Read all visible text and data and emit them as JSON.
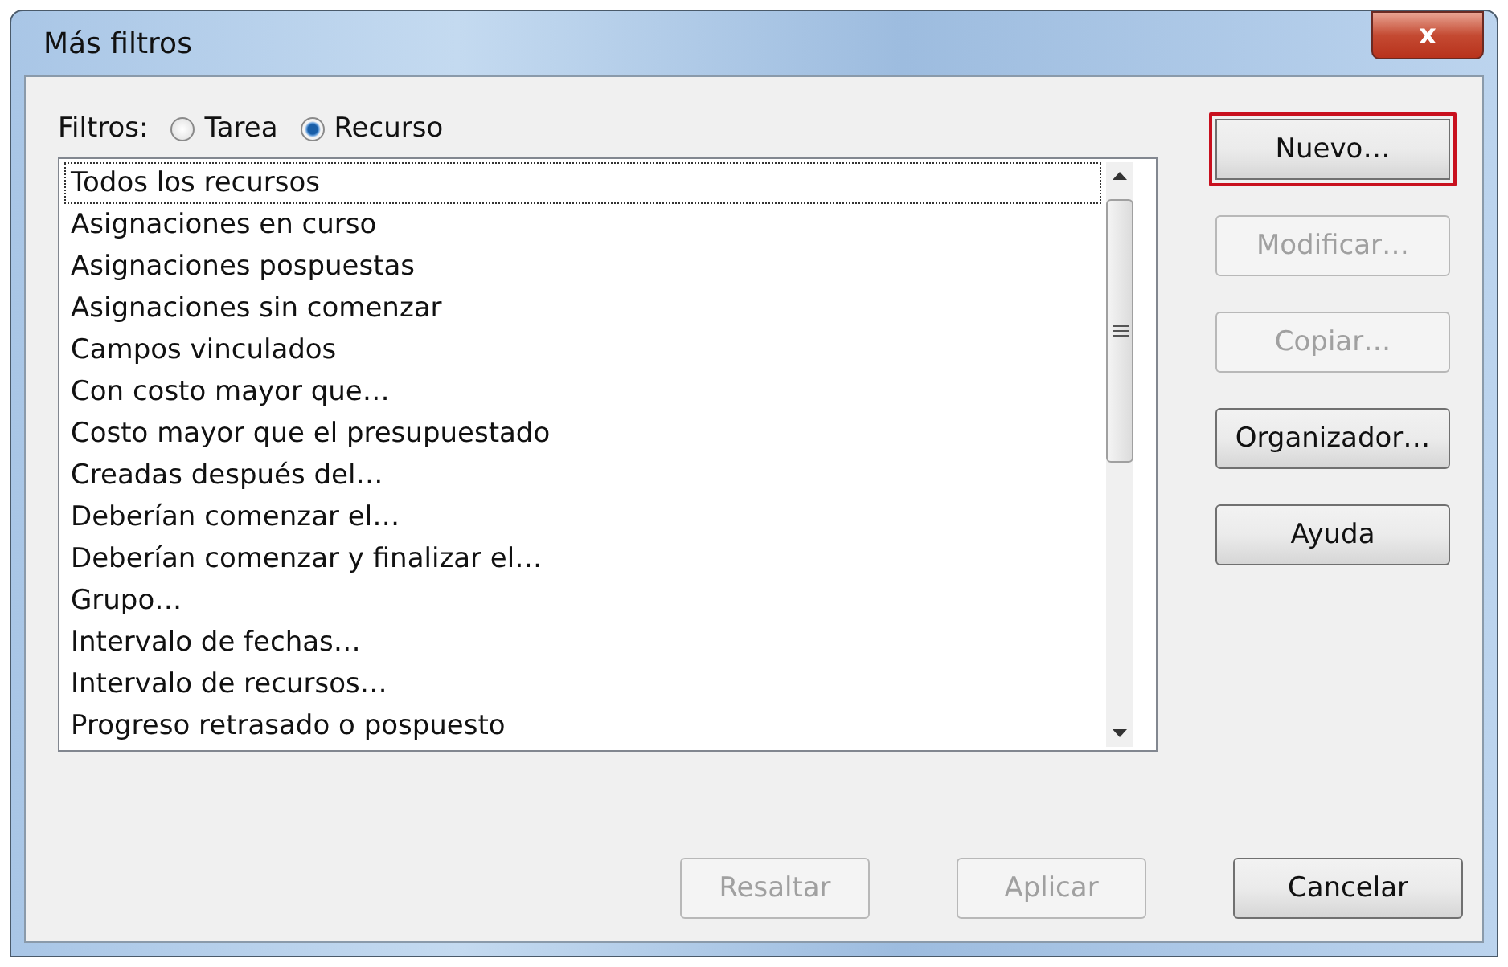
{
  "window": {
    "title": "Más filtros",
    "close": "x"
  },
  "filter_type": {
    "label": "Filtros:",
    "options": [
      {
        "label": "Tarea",
        "selected": false
      },
      {
        "label": "Recurso",
        "selected": true
      }
    ]
  },
  "filter_list": {
    "items": [
      {
        "label": "Todos los recursos",
        "focused": true
      },
      {
        "label": "Asignaciones en curso",
        "focused": false
      },
      {
        "label": "Asignaciones pospuestas",
        "focused": false
      },
      {
        "label": "Asignaciones sin comenzar",
        "focused": false
      },
      {
        "label": "Campos vinculados",
        "focused": false
      },
      {
        "label": "Con costo mayor que…",
        "focused": false
      },
      {
        "label": "Costo mayor que el presupuestado",
        "focused": false
      },
      {
        "label": "Creadas después del…",
        "focused": false
      },
      {
        "label": "Deberían comenzar el…",
        "focused": false
      },
      {
        "label": "Deberían comenzar y finalizar el…",
        "focused": false
      },
      {
        "label": "Grupo…",
        "focused": false
      },
      {
        "label": "Intervalo de fechas…",
        "focused": false
      },
      {
        "label": "Intervalo de recursos…",
        "focused": false
      },
      {
        "label": "Progreso retrasado o pospuesto",
        "focused": false
      }
    ]
  },
  "side_buttons": [
    {
      "label": "Nuevo…",
      "disabled": false,
      "highlighted": true
    },
    {
      "label": "Modificar…",
      "disabled": true,
      "highlighted": false
    },
    {
      "label": "Copiar…",
      "disabled": true,
      "highlighted": false
    },
    {
      "label": "Organizador…",
      "disabled": false,
      "highlighted": false
    },
    {
      "label": "Ayuda",
      "disabled": false,
      "highlighted": false
    }
  ],
  "bottom_buttons": [
    {
      "label": "Resaltar",
      "disabled": true
    },
    {
      "label": "Aplicar",
      "disabled": true
    },
    {
      "label": "Cancelar",
      "disabled": false
    }
  ]
}
